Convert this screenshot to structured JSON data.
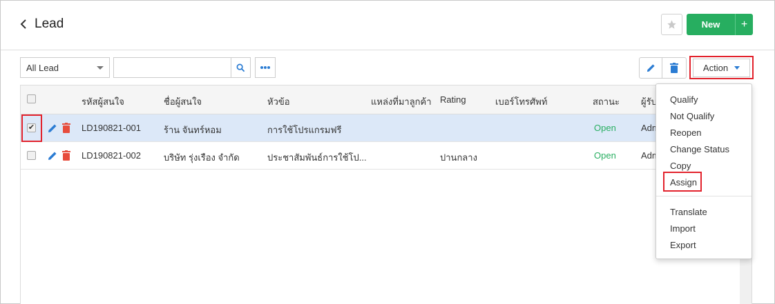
{
  "header": {
    "title": "Lead",
    "new_label": "New",
    "new_plus": "+"
  },
  "toolbar": {
    "filter_value": "All Lead",
    "search_placeholder": "",
    "action_label": "Action"
  },
  "table": {
    "columns": [
      "รหัสผู้สนใจ",
      "ชื่อผู้สนใจ",
      "หัวข้อ",
      "แหล่งที่มาลูกค้า",
      "Rating",
      "เบอร์โทรศัพท์",
      "สถานะ",
      "ผู้รับ"
    ],
    "rows": [
      {
        "id": "LD190821-001",
        "name": "ร้าน จันทร์หอม",
        "topic": "การใช้โปรแกรมฟรี",
        "source": "",
        "rating": "",
        "phone": "",
        "status": "Open",
        "owner": "Adm",
        "selected": true
      },
      {
        "id": "LD190821-002",
        "name": "บริษัท รุ่งเรือง จำกัด",
        "topic": "ประชาสัมพันธ์การใช้โป...",
        "source": "",
        "rating": "ปานกลาง",
        "phone": "",
        "status": "Open",
        "owner": "Adm",
        "selected": false
      }
    ]
  },
  "action_menu": {
    "items": [
      "Qualify",
      "Not Qualify",
      "Reopen",
      "Change Status",
      "Copy",
      "Assign"
    ],
    "items_secondary": [
      "Translate",
      "Import",
      "Export"
    ]
  },
  "colors": {
    "accent_green": "#27ae60",
    "accent_blue": "#2b7cd3",
    "highlight_red": "#e2212b",
    "delete_red": "#e74c3c",
    "row_selected": "#dce8f8"
  },
  "icons": {
    "back": "chevron-left-icon",
    "favorite": "star-icon",
    "search": "search-icon",
    "more": "more-horizontal-icon",
    "edit": "pencil-icon",
    "delete": "trash-icon"
  }
}
